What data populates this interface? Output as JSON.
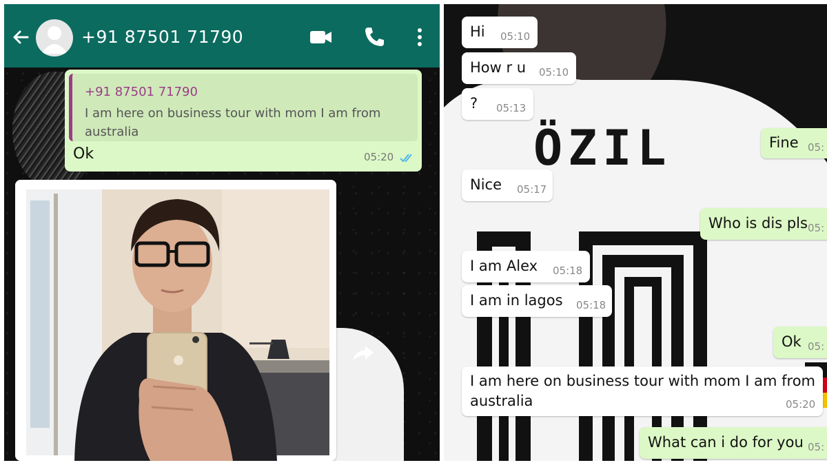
{
  "left_chat": {
    "header": {
      "contact": "+91 87501 71790",
      "icons": [
        "back-arrow-icon",
        "avatar",
        "video-call-icon",
        "phone-icon",
        "more-vert-icon"
      ],
      "background_color": "#0b6b5f"
    },
    "reply_message": {
      "quoted_sender": "+91 87501 71790",
      "quoted_text": "I am here on business tour with mom I am from australia",
      "text": "Ok",
      "time": "05:20",
      "status": "read-double-tick"
    },
    "image_message": {
      "content": "selfie-photo",
      "forward_icon": "forward-icon"
    }
  },
  "right_chat": {
    "jersey_print": "ÖZIL",
    "messages": [
      {
        "direction": "in",
        "text": "Hi",
        "time": "05:10"
      },
      {
        "direction": "in",
        "text": "How r u",
        "time": "05:10"
      },
      {
        "direction": "in",
        "text": "?",
        "time": "05:13"
      },
      {
        "direction": "out",
        "text": "Fine",
        "time": "05:"
      },
      {
        "direction": "in",
        "text": "Nice",
        "time": "05:17"
      },
      {
        "direction": "out",
        "text": "Who is dis pls",
        "time": "05:"
      },
      {
        "direction": "in",
        "text": "I am Alex",
        "time": "05:18"
      },
      {
        "direction": "in",
        "text": "I am in lagos",
        "time": "05:18"
      },
      {
        "direction": "out",
        "text": "Ok",
        "time": "05:"
      },
      {
        "direction": "in",
        "text": "I am here on business tour with mom I am from",
        "text_line2": "australia",
        "time": "05:20"
      },
      {
        "direction": "out",
        "text": "What can i do for you",
        "time": "05:"
      }
    ]
  },
  "colors": {
    "outgoing_bubble": "#dcf8c6",
    "incoming_bubble": "#ffffff",
    "quote_accent": "#9a3d87",
    "read_tick": "#4fb6ec"
  }
}
